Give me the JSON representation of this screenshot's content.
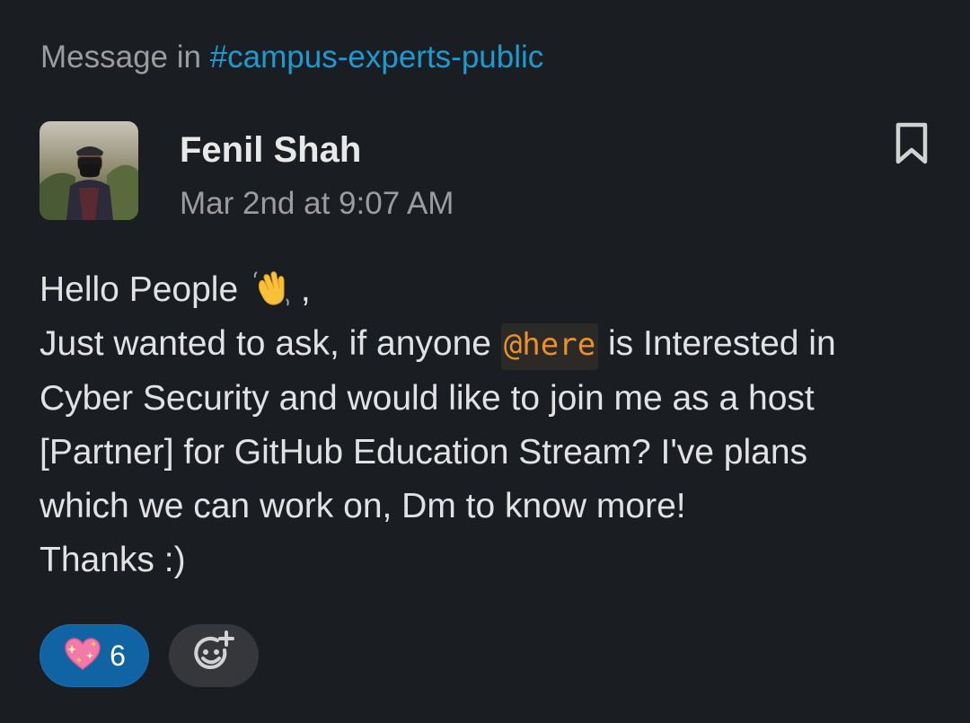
{
  "header": {
    "prefix": "Message in ",
    "channel": "#campus-experts-public"
  },
  "message": {
    "author": "Fenil Shah",
    "timestamp": "Mar 2nd at 9:07 AM",
    "lines": {
      "l1_text": "Hello People",
      "l1_emoji": "waving-hand-emoji",
      "l1_suffix": " ,",
      "l2_before": "Just wanted to ask, if anyone ",
      "l2_mention": "@here",
      "l2_after": " is Interested in",
      "l3": "Cyber Security and would like to join me as a host",
      "l4": "[Partner] for GitHub Education Stream? I've plans",
      "l5": "which we can work on, Dm to know more!",
      "l6": "Thanks :)"
    }
  },
  "reactions": [
    {
      "emoji": "sparkling-heart-emoji",
      "count": "6"
    }
  ],
  "colors": {
    "background": "#1a1d21",
    "channel_link": "#1d9bd1",
    "mention": "#e8912d",
    "reaction_active": "#1164a3"
  }
}
